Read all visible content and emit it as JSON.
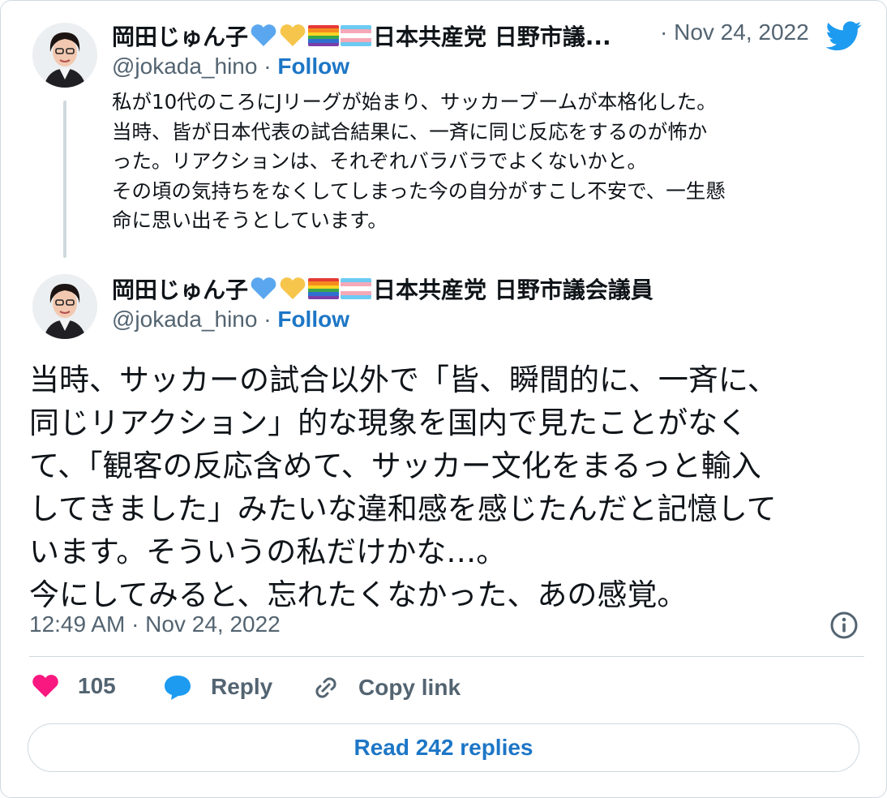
{
  "tweet1": {
    "display_name": "岡田じゅん子",
    "org_truncated": "日本共産党 日野市議...",
    "date": "· Nov 24, 2022",
    "handle": "@jokada_hino",
    "sep": " · ",
    "follow": "Follow",
    "lines": [
      "私が10代のころにJリーグが始まり、サッカーブームが本格化した。",
      "当時、皆が日本代表の試合結果に、一斉に同じ反応をするのが怖か",
      "った。リアクションは、それぞれバラバラでよくないかと。",
      "その頃の気持ちをなくしてしまった今の自分がすこし不安で、一生懸",
      "命に思い出そうとしています。"
    ]
  },
  "tweet2": {
    "display_name": "岡田じゅん子",
    "org": "日本共産党 日野市議会議員",
    "handle": "@jokada_hino",
    "sep": " · ",
    "follow": "Follow",
    "lines": [
      "当時、サッカーの試合以外で「皆、瞬間的に、一斉に、",
      "同じリアクション」的な現象を国内で見たことがなく",
      "て、「観客の反応含めて、サッカー文化をまるっと輸入",
      "してきました」みたいな違和感を感じたんだと記憶して",
      "います。そういうの私だけかな…。",
      "今にしてみると、忘れたくなかった、あの感覚。"
    ],
    "timestamp": "12:49 AM · Nov 24, 2022"
  },
  "actions": {
    "like_count": "105",
    "reply": "Reply",
    "copy_link": "Copy link"
  },
  "read_replies": "Read 242 replies",
  "icons": {
    "brand": "twitter-bird-icon",
    "like": "heart-icon",
    "reply": "speech-bubble-icon",
    "copy": "link-icon",
    "info": "info-icon"
  },
  "colors": {
    "like": "#f91880",
    "reply": "#1d9bf0",
    "link_text": "#1d76c6",
    "twitter": "#1d9bf0",
    "blue_heart": "#5aa7ef",
    "yellow_heart": "#f6c54b"
  }
}
